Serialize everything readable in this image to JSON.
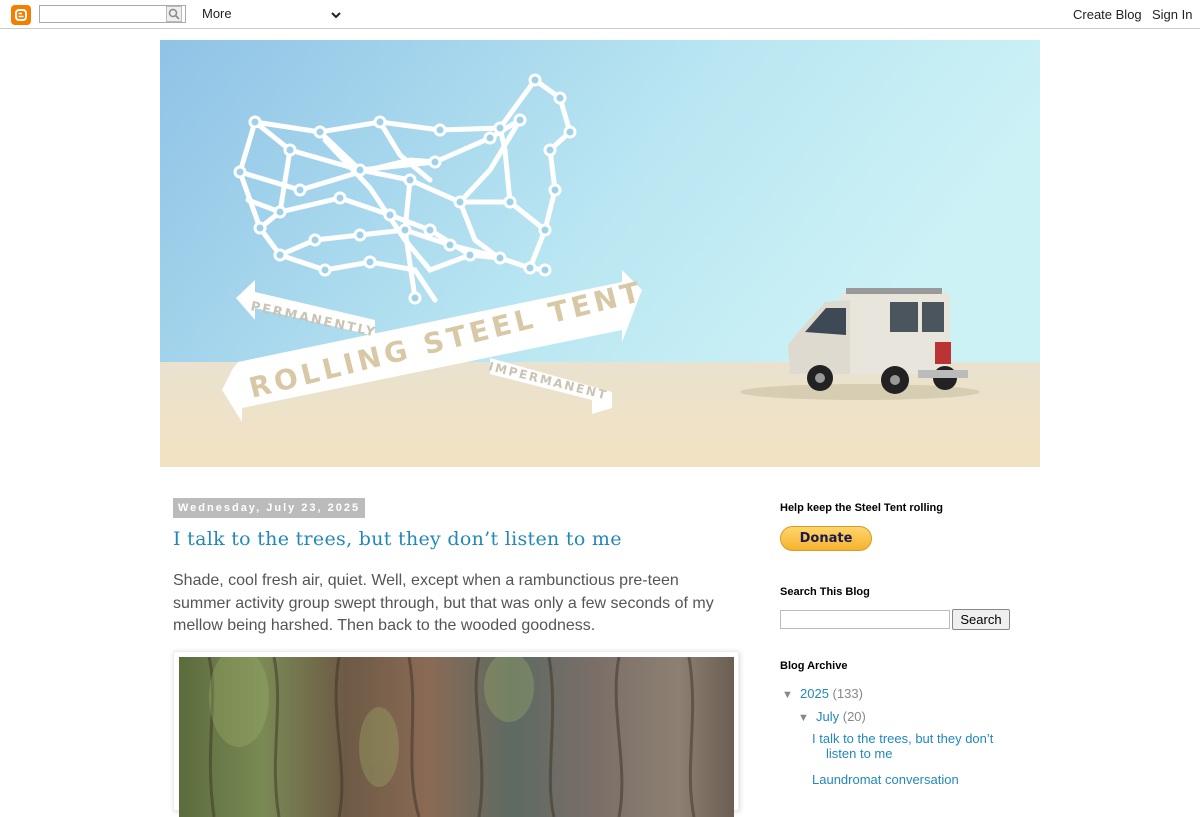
{
  "navbar": {
    "more_label": "More",
    "create_blog": "Create Blog",
    "sign_in": "Sign In",
    "search_value": ""
  },
  "header": {
    "banner_title": "ROLLING STEEL TENT",
    "arrow_left_text": "PERMANENTLY",
    "arrow_right_text": "IMPERMANENT"
  },
  "post": {
    "date": "Wednesday, July 23, 2025",
    "title": "I talk to the trees, but they don’t listen to me",
    "body_line1": "Shade, cool fresh air, quiet. Well, except when a rambunctious pre-teen",
    "body_line2": "summer activity group swept through, but that was only a few seconds of my",
    "body_line3": "mellow being harshed. Then back to the wooded goodness."
  },
  "sidebar": {
    "donate_heading": "Help keep the Steel Tent rolling",
    "donate_label": "Donate",
    "search_heading": "Search This Blog",
    "search_button": "Search",
    "archive_heading": "Blog Archive",
    "archive": {
      "year": "2025",
      "year_count": "(133)",
      "month": "July",
      "month_count": "(20)",
      "posts": [
        {
          "line1": "I talk to the trees, but they don’t",
          "line2": "listen to me"
        },
        {
          "line1": "Laundromat conversation",
          "line2": ""
        }
      ]
    }
  },
  "colors": {
    "link": "#2288bb",
    "date_bg": "#bbbbbb",
    "blogger_orange": "#f57d00"
  }
}
